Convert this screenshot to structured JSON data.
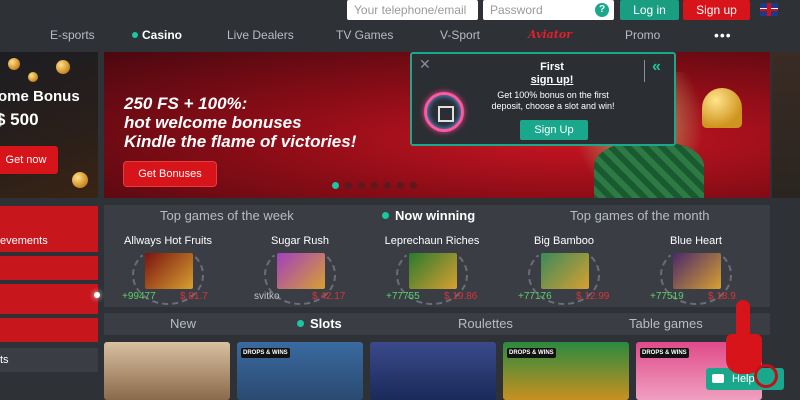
{
  "header": {
    "phone_placeholder": "Your telephone/email",
    "password_placeholder": "Password",
    "password_help": "?",
    "login_label": "Log in",
    "signup_label": "Sign up"
  },
  "nav": {
    "items": [
      "E-sports",
      "Casino",
      "Live Dealers",
      "TV Games",
      "V-Sport",
      "Promo"
    ],
    "special_label": "Aviator",
    "more": "•••"
  },
  "left_promo": {
    "title_line1": "ome Bonus",
    "title_line2": "$ 500",
    "button": "Get now"
  },
  "banner": {
    "headline_line1": "250 FS + 100%:",
    "headline_line2": "hot welcome bonuses",
    "headline_line3": "Kindle the flame of victories!",
    "button": "Get Bonuses",
    "slides": 7,
    "active_slide": 1
  },
  "popup": {
    "title": "First",
    "subtitle": "sign up!",
    "body": "Get 100% bonus on the first deposit, choose a slot and win!",
    "button": "Sign Up",
    "close": "✕",
    "collapse": "«"
  },
  "left_menu": {
    "item2": "evements",
    "dark_item": "ts"
  },
  "games": {
    "tabs": [
      "Top games of the week",
      "Now winning",
      "Top games of the month"
    ],
    "active_tab": "Now winning",
    "cards": [
      {
        "name": "Allways Hot Fruits",
        "left": "+99477",
        "right": "$ 81.7",
        "color": "#7a1410"
      },
      {
        "name": "Sugar Rush",
        "left": "svitko",
        "right": "$ 42.17",
        "color": "#a040c0"
      },
      {
        "name": "Leprechaun Riches",
        "left": "+77755",
        "right": "$ 19.86",
        "color": "#2a7a30"
      },
      {
        "name": "Big Bamboo",
        "left": "+77176",
        "right": "$ 12.99",
        "color": "#3a8a5a"
      },
      {
        "name": "Blue Heart",
        "left": "+77519",
        "right": "$ 18.9",
        "color": "#4a2a6a"
      }
    ]
  },
  "sections": {
    "tabs": [
      "New",
      "Slots",
      "Roulettes",
      "Table games"
    ],
    "active_tab": "Slots"
  },
  "tiles": {
    "badge": "DROPS & WINS"
  },
  "help": {
    "label": "Help"
  },
  "colors": {
    "brand_red": "#d8141b",
    "accent_green": "#1aa88d",
    "background": "#2e3136",
    "panel": "#3a3d44"
  }
}
